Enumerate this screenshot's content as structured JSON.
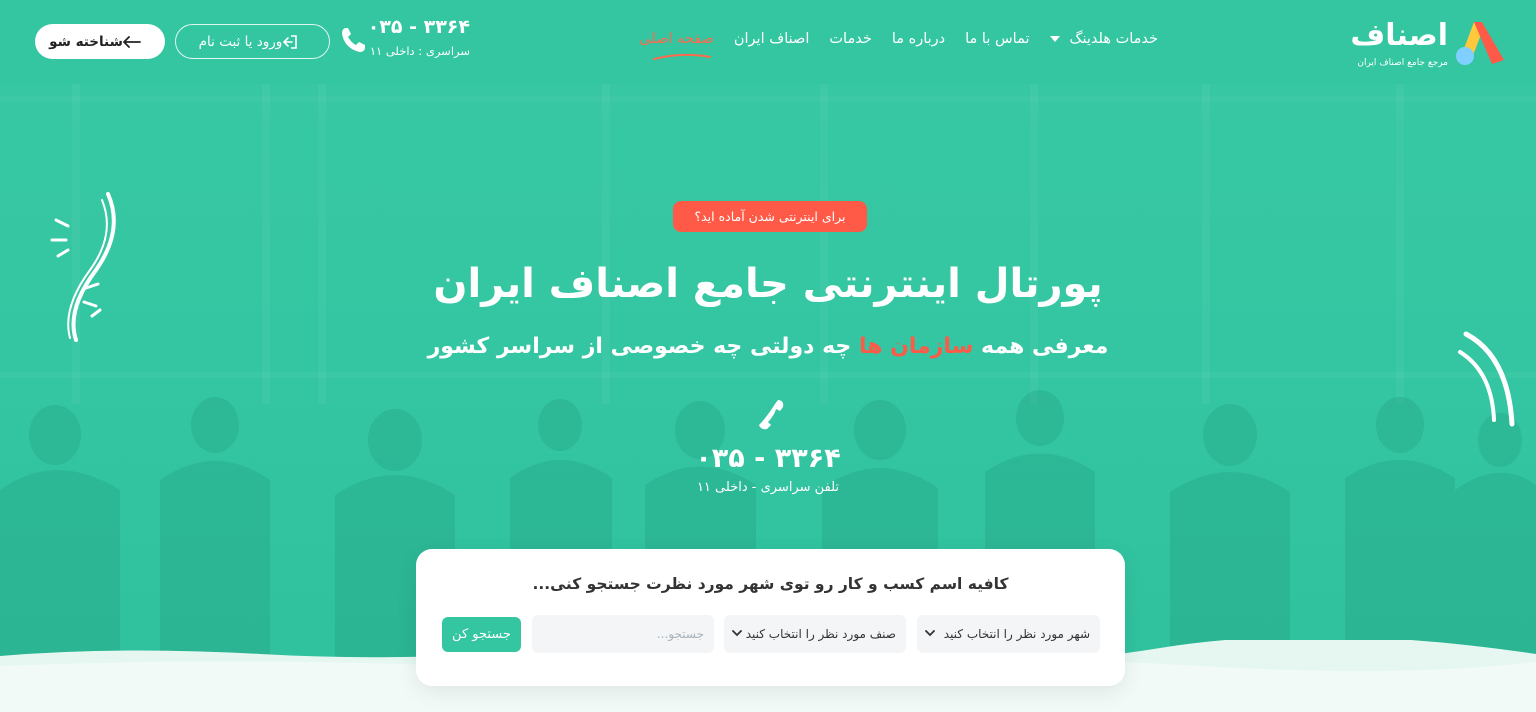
{
  "brand": {
    "name": "اصناف",
    "tagline": "مرجع جامع اصناف ایران"
  },
  "nav": {
    "items": [
      {
        "label": "صفحه اصلی",
        "active": true
      },
      {
        "label": "اصناف ایران"
      },
      {
        "label": "خدمات"
      },
      {
        "label": "درباره ما"
      },
      {
        "label": "تماس با ما"
      },
      {
        "label": "خدمات هلدینگ"
      }
    ]
  },
  "contact": {
    "phone": "۰۳۵ - ۳۳۶۴",
    "extension": "سراسری : داخلی ۱۱"
  },
  "auth": {
    "login_label": "ورود یا ثبت نام",
    "known_label": "شناخته شو"
  },
  "hero": {
    "badge": "برای اینترنتی شدن آماده اید؟",
    "title": "پورتال اینترنتی جامع اصناف ایران",
    "subtitle_before": "معرفی همه",
    "subtitle_highlight": "سازمان ها",
    "subtitle_after": "چه دولتی چه خصوصی از سراسر کشور",
    "phone": "۰۳۵ - ۳۳۶۴",
    "phone_sub": "تلفن سراسری - داخلی ۱۱"
  },
  "search": {
    "title": "کافیه اسم کسب و کار رو توی شهر مورد نظرت جستجو کنی...",
    "city_placeholder": "شهر مورد نظر را انتخاب کنید",
    "class_placeholder": "صنف مورد نظر را انتخاب کنید",
    "query_placeholder": "جستجو...",
    "button_label": "جستجو کن"
  },
  "colors": {
    "primary": "#33c6a1",
    "accent": "#ff5a47",
    "white": "#ffffff"
  }
}
